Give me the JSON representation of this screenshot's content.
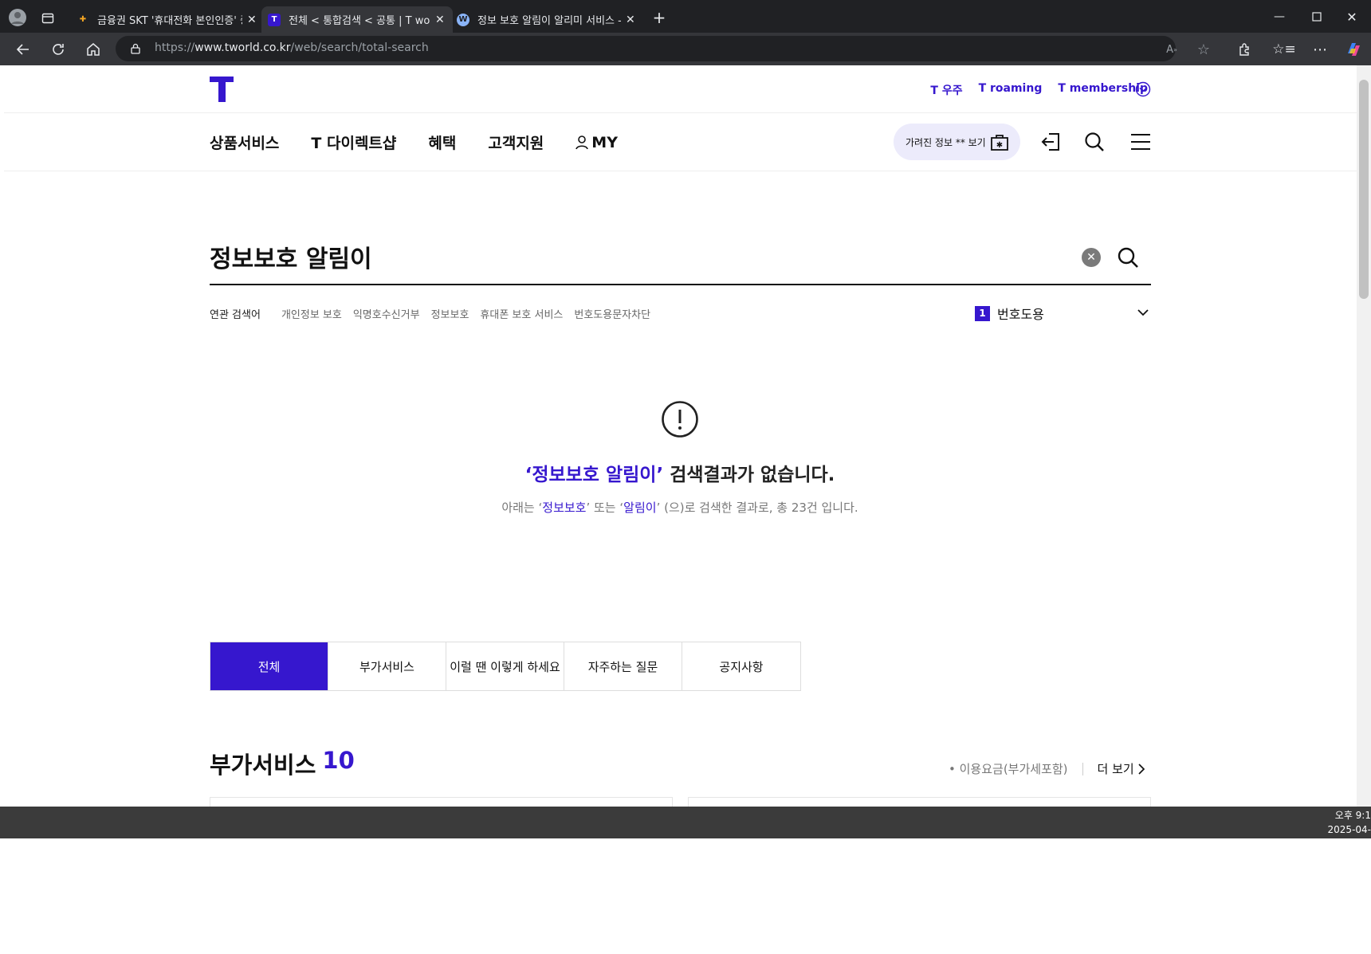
{
  "browser": {
    "tabs": [
      {
        "title": "금융권 SKT '휴대전화 본인인증' 중"
      },
      {
        "title": "전체 < 통합검색 < 공통 | T world"
      },
      {
        "title": "정보 보호 알림이 알리미 서비스 -"
      }
    ],
    "url_prefix": "https://",
    "url_host": "www.tworld.co.kr",
    "url_path": "/web/search/total-search"
  },
  "header": {
    "toplinks": [
      "T 우주",
      "T roaming",
      "T membership"
    ],
    "gnb": [
      "상품서비스",
      "T 다이렉트샵",
      "혜택",
      "고객지원",
      "MY"
    ],
    "masked_info": "가려진 정보 ** 보기"
  },
  "search": {
    "query": "정보보호 알림이",
    "related_label": "연관 검색어",
    "related": [
      "개인정보 보호",
      "익명호수신거부",
      "정보보호",
      "휴대폰 보호 서비스",
      "번호도용문자차단"
    ],
    "rank_number": "1",
    "rank_keyword": "번호도용"
  },
  "empty_state": {
    "quote_open": "‘",
    "query_highlight": "정보보호 알림이",
    "quote_close": "’",
    "message": " 검색결과가 없습니다.",
    "sub_prefix": "아래는 ‘",
    "sub_term1": "정보보호",
    "sub_mid": "’ 또는 ‘",
    "sub_term2": "알림이",
    "sub_suffix": "’ (으)로 검색한 결과로, 총 23건 입니다."
  },
  "content_tabs": [
    "전체",
    "부가서비스",
    "이럴 땐 이렇게 하세요",
    "자주하는 질문",
    "공지사항"
  ],
  "section": {
    "title": "부가서비스",
    "count": "10",
    "fee_note": "• 이용요금(부가세포함)",
    "more": "더 보기"
  },
  "taskbar": {
    "clock_line1": "오후 9:1",
    "clock_line2": "2025-04-"
  },
  "colors": {
    "brand": "#3617ce",
    "chrome_bg": "#202124"
  }
}
